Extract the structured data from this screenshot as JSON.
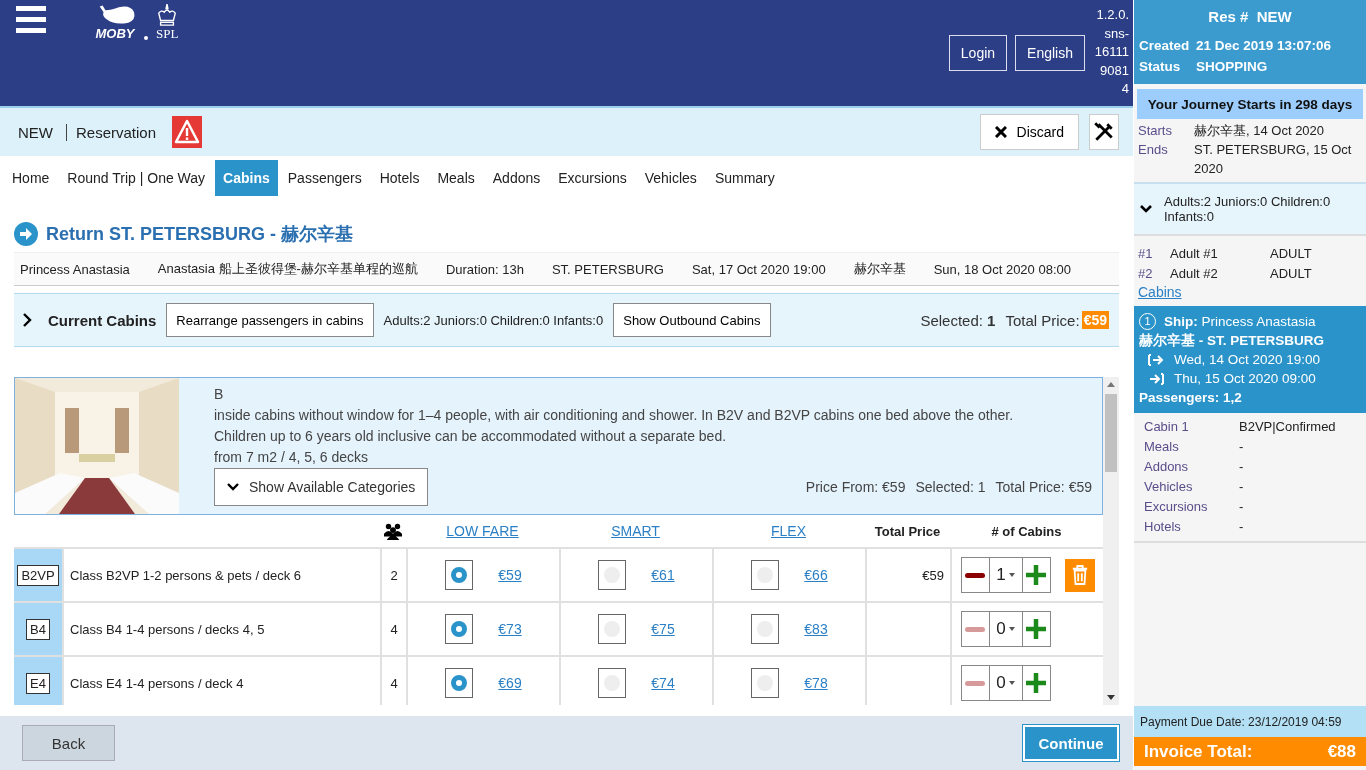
{
  "header": {
    "logo": [
      "MOBY",
      "SPL"
    ],
    "buttons": [
      "Login",
      "English"
    ],
    "version": [
      "1.2.0.",
      "sns-",
      "16111",
      "9081",
      "4"
    ]
  },
  "toolbar": {
    "status": "NEW",
    "title": "Reservation",
    "discard": "Discard"
  },
  "nav": [
    {
      "label": "Home",
      "selected": false
    },
    {
      "label": "Round Trip | One Way",
      "selected": false
    },
    {
      "label": "Cabins",
      "selected": true
    },
    {
      "label": "Passengers",
      "selected": false
    },
    {
      "label": "Hotels",
      "selected": false
    },
    {
      "label": "Meals",
      "selected": false
    },
    {
      "label": "Addons",
      "selected": false
    },
    {
      "label": "Excursions",
      "selected": false
    },
    {
      "label": "Vehicles",
      "selected": false
    },
    {
      "label": "Summary",
      "selected": false
    }
  ],
  "trip": {
    "title": "Return ST. PETERSBURG - 赫尔辛基",
    "details": [
      "Princess Anastasia",
      "Anastasia 船上圣彼得堡-赫尔辛基单程的巡航",
      "Duration: 13h",
      "ST. PETERSBURG",
      "Sat, 17 Oct 2020 19:00",
      "赫尔辛基",
      "Sun, 18 Oct 2020 08:00"
    ]
  },
  "current": {
    "label": "Current Cabins",
    "expanded": false,
    "rearrange": "Rearrange passengers in cabins",
    "counts": "Adults:2 Juniors:0 Children:0 Infants:0",
    "outbound": "Show Outbound Cabins",
    "selected_label": "Selected:",
    "selected": "1",
    "total_label": "Total Price:",
    "total": "€59"
  },
  "category": {
    "code": "B",
    "description": [
      "inside cabins without window for 1–4 people, with air conditioning and shower. In B2V and B2VP cabins one bed above the other.",
      "Children up to 6 years old inclusive can be accommodated without a separate bed.",
      "from 7 m2 / 4, 5, 6 decks"
    ],
    "show": "Show Available Categories",
    "price_from": "Price From: €59",
    "selected": "Selected: 1",
    "total": "Total Price: €59"
  },
  "table": {
    "columns": [
      "LOW FARE",
      "SMART",
      "FLEX",
      "Total Price",
      "# of Cabins"
    ],
    "rows": [
      {
        "code": "B2VP",
        "name": "Class B2VP 1-2 persons & pets / deck 6",
        "capacity": "2",
        "fares": [
          {
            "price": "€59",
            "selected": true
          },
          {
            "price": "€61",
            "selected": false
          },
          {
            "price": "€66",
            "selected": false
          }
        ],
        "total": "€59",
        "count": "1",
        "minus_disabled": false,
        "removable": true
      },
      {
        "code": "B4",
        "name": "Class B4 1-4 persons / decks 4, 5",
        "capacity": "4",
        "fares": [
          {
            "price": "€73",
            "selected": true
          },
          {
            "price": "€75",
            "selected": false
          },
          {
            "price": "€83",
            "selected": false
          }
        ],
        "count": "0",
        "minus_disabled": true,
        "removable": false
      },
      {
        "code": "E4",
        "name": "Class E4 1-4 persons / deck 4",
        "capacity": "4",
        "fares": [
          {
            "price": "€69",
            "selected": true
          },
          {
            "price": "€74",
            "selected": false
          },
          {
            "price": "€78",
            "selected": false
          }
        ],
        "count": "0",
        "minus_disabled": true,
        "removable": false
      }
    ]
  },
  "footer": {
    "back": "Back",
    "continue": "Continue"
  },
  "sidebar": {
    "res_label": "Res #",
    "res_value": "NEW",
    "created_label": "Created",
    "created": "21 Dec 2019 13:07:06",
    "status_label": "Status",
    "status": "SHOPPING",
    "journey": "Your Journey Starts in 298 days",
    "dates": [
      {
        "label": "Starts",
        "value": "赫尔辛基, 14 Oct 2020"
      },
      {
        "label": "Ends",
        "value": "ST. PETERSBURG, 15 Oct 2020"
      }
    ],
    "pax_summary": "Adults:2 Juniors:0 Children:0 Infants:0",
    "pax_expanded": true,
    "passengers": [
      {
        "num": "#1",
        "name": "Adult #1",
        "type": "ADULT"
      },
      {
        "num": "#2",
        "name": "Adult #2",
        "type": "ADULT"
      }
    ],
    "cabins_link": "Cabins",
    "segment": {
      "number": "1",
      "ship_label": "Ship:",
      "ship": "Princess Anastasia",
      "route": "赫尔辛基 - ST. PETERSBURG",
      "depart": "Wed, 14 Oct 2020 19:00",
      "arrive": "Thu, 15 Oct 2020 09:00",
      "passengers": "Passengers: 1,2"
    },
    "services": [
      {
        "label": "Cabin 1",
        "value": "B2VP|Confirmed"
      },
      {
        "label": "Meals",
        "value": "-"
      },
      {
        "label": "Addons",
        "value": "-"
      },
      {
        "label": "Vehicles",
        "value": "-"
      },
      {
        "label": "Excursions",
        "value": "-"
      },
      {
        "label": "Hotels",
        "value": "-"
      }
    ],
    "payment_due": "Payment Due Date: 23/12/2019 04:59",
    "invoice_label": "Invoice Total:",
    "invoice_total": "€88"
  }
}
